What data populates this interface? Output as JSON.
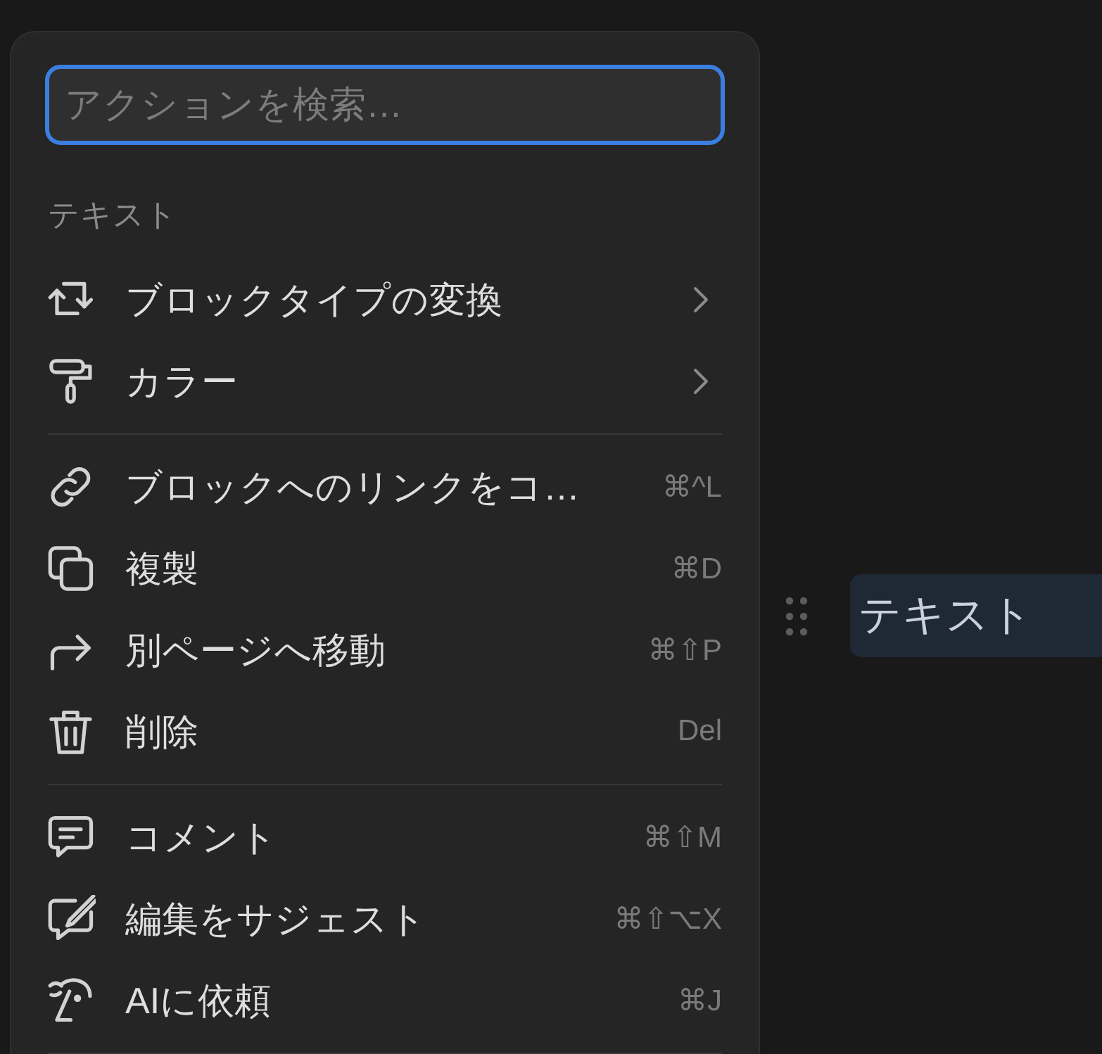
{
  "menu": {
    "search": {
      "placeholder": "アクションを検索…",
      "focused": true
    },
    "sections": [
      {
        "label": "テキスト",
        "items": [
          {
            "kind": "submenu",
            "label": "ブロックタイプの変換"
          },
          {
            "kind": "submenu",
            "label": "カラー"
          }
        ]
      },
      {
        "items": [
          {
            "kind": "action",
            "label": "ブロックへのリンクをコ…",
            "shortcut": "⌘^L"
          },
          {
            "kind": "action",
            "label": "複製",
            "shortcut": "⌘D"
          },
          {
            "kind": "action",
            "label": "別ページへ移動",
            "shortcut": "⌘⇧P"
          },
          {
            "kind": "action",
            "label": "削除",
            "shortcut": "Del"
          }
        ]
      },
      {
        "items": [
          {
            "kind": "action",
            "label": "コメント",
            "shortcut": "⌘⇧M"
          },
          {
            "kind": "action",
            "label": "編集をサジェスト",
            "shortcut": "⌘⇧⌥X"
          },
          {
            "kind": "action",
            "label": "AIに依頼",
            "shortcut": "⌘J"
          }
        ]
      }
    ]
  },
  "block": {
    "text": "テキスト",
    "selected": true
  }
}
